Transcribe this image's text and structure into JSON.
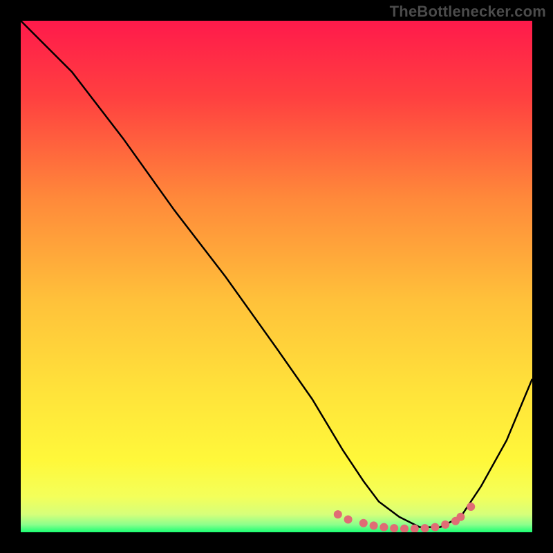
{
  "watermark": "TheBottlenecker.com",
  "chart_data": {
    "type": "line",
    "title": "",
    "xlabel": "",
    "ylabel": "",
    "xlim": [
      0,
      100
    ],
    "ylim": [
      0,
      100
    ],
    "grid": false,
    "legend": false,
    "series": [
      {
        "name": "curve",
        "color": "#000000",
        "x": [
          0,
          4,
          10,
          20,
          30,
          40,
          50,
          57,
          63,
          67,
          70,
          74,
          78,
          82,
          86,
          90,
          95,
          100
        ],
        "y": [
          100,
          96,
          90,
          77,
          63,
          50,
          36,
          26,
          16,
          10,
          6,
          3,
          1,
          1,
          3,
          9,
          18,
          30
        ]
      },
      {
        "name": "markers",
        "color": "#e06c75",
        "type": "scatter",
        "x": [
          62,
          64,
          67,
          69,
          71,
          73,
          75,
          77,
          79,
          81,
          83,
          85,
          86,
          88
        ],
        "y": [
          3.5,
          2.5,
          1.8,
          1.3,
          1.0,
          0.8,
          0.7,
          0.7,
          0.8,
          1.0,
          1.5,
          2.2,
          3.0,
          5.0
        ]
      }
    ],
    "background_gradient": {
      "stops": [
        {
          "offset": 0.0,
          "color": "#ff1a4b"
        },
        {
          "offset": 0.15,
          "color": "#ff4040"
        },
        {
          "offset": 0.35,
          "color": "#ff8a3a"
        },
        {
          "offset": 0.55,
          "color": "#ffc23a"
        },
        {
          "offset": 0.72,
          "color": "#ffe23a"
        },
        {
          "offset": 0.86,
          "color": "#fff83a"
        },
        {
          "offset": 0.93,
          "color": "#f4ff5a"
        },
        {
          "offset": 0.965,
          "color": "#d6ff7a"
        },
        {
          "offset": 0.985,
          "color": "#8cff8c"
        },
        {
          "offset": 1.0,
          "color": "#1aff73"
        }
      ]
    }
  }
}
